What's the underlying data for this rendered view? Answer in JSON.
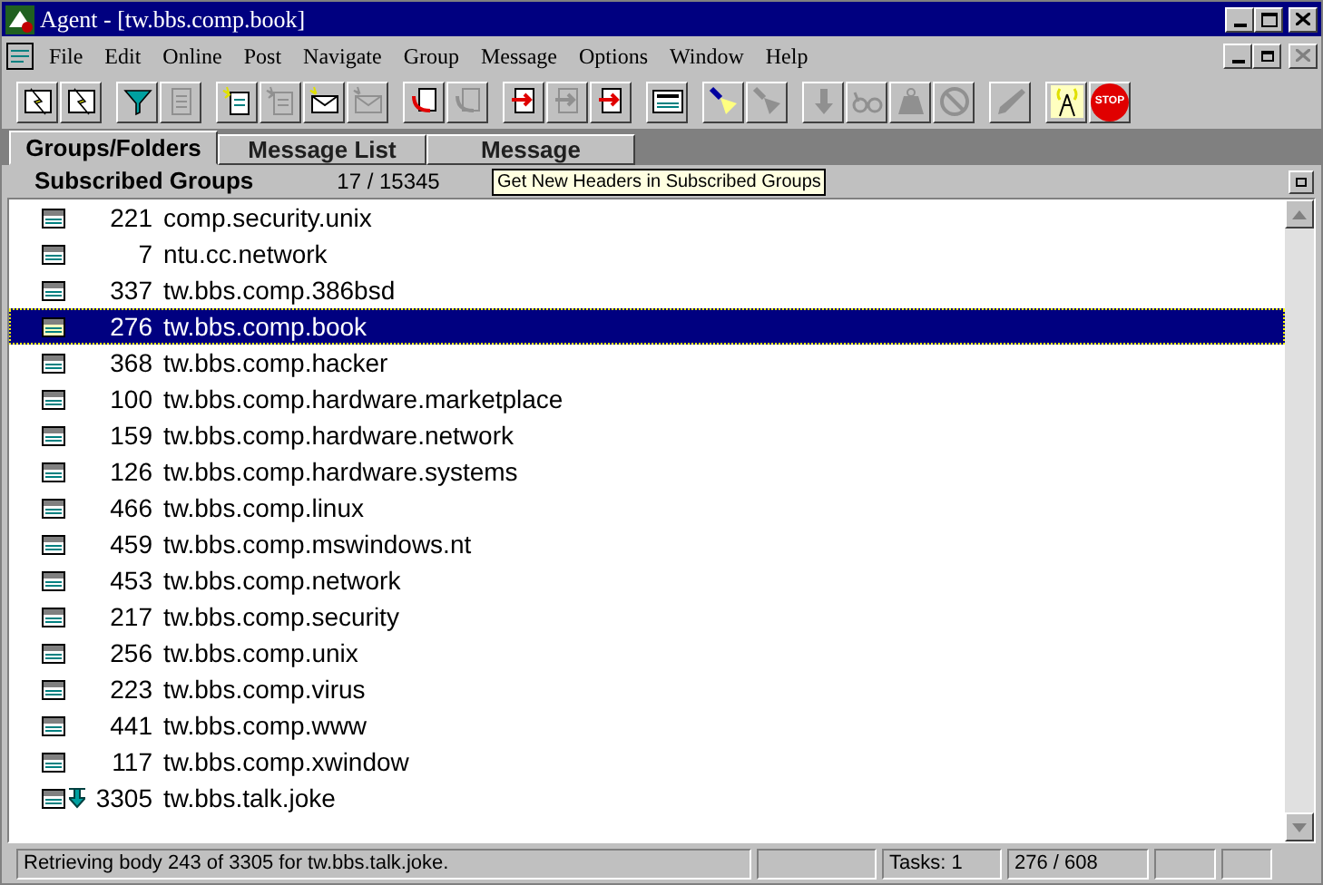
{
  "window": {
    "title": "Agent - [tw.bbs.comp.book]"
  },
  "menu": [
    "File",
    "Edit",
    "Online",
    "Post",
    "Navigate",
    "Group",
    "Message",
    "Options",
    "Window",
    "Help"
  ],
  "toolbar": [
    {
      "kind": "lightning",
      "disabled": false
    },
    {
      "kind": "lightning",
      "disabled": false
    },
    {
      "kind": "sep"
    },
    {
      "kind": "funnel",
      "disabled": false
    },
    {
      "kind": "page",
      "disabled": true
    },
    {
      "kind": "sep"
    },
    {
      "kind": "newpage",
      "disabled": false
    },
    {
      "kind": "newpage",
      "disabled": true
    },
    {
      "kind": "mail",
      "disabled": false
    },
    {
      "kind": "mail",
      "disabled": true
    },
    {
      "kind": "sep"
    },
    {
      "kind": "reply",
      "disabled": false
    },
    {
      "kind": "reply",
      "disabled": true
    },
    {
      "kind": "sep"
    },
    {
      "kind": "forward",
      "disabled": false
    },
    {
      "kind": "forward",
      "disabled": true
    },
    {
      "kind": "forward",
      "disabled": false
    },
    {
      "kind": "sep"
    },
    {
      "kind": "extra",
      "disabled": false
    },
    {
      "kind": "sep"
    },
    {
      "kind": "flashlight",
      "disabled": false
    },
    {
      "kind": "flashlight",
      "disabled": true
    },
    {
      "kind": "sep"
    },
    {
      "kind": "down",
      "disabled": true
    },
    {
      "kind": "glasses",
      "disabled": true
    },
    {
      "kind": "weight",
      "disabled": true
    },
    {
      "kind": "nosign",
      "disabled": true
    },
    {
      "kind": "sep"
    },
    {
      "kind": "pen",
      "disabled": true
    },
    {
      "kind": "sep"
    },
    {
      "kind": "antenna",
      "disabled": false
    },
    {
      "kind": "stop",
      "disabled": false,
      "label": "STOP"
    }
  ],
  "tabs": [
    {
      "label": "Groups/Folders",
      "selected": true
    },
    {
      "label": "Message List",
      "selected": false
    },
    {
      "label": "Message",
      "selected": false
    }
  ],
  "tooltip": "Get New Headers in Subscribed Groups",
  "panel": {
    "title": "Subscribed Groups",
    "count": "17 / 15345"
  },
  "groups": [
    {
      "count": "221",
      "name": "comp.security.unix",
      "selected": false,
      "retrieving": false
    },
    {
      "count": "7",
      "name": "ntu.cc.network",
      "selected": false,
      "retrieving": false
    },
    {
      "count": "337",
      "name": "tw.bbs.comp.386bsd",
      "selected": false,
      "retrieving": false
    },
    {
      "count": "276",
      "name": "tw.bbs.comp.book",
      "selected": true,
      "retrieving": false
    },
    {
      "count": "368",
      "name": "tw.bbs.comp.hacker",
      "selected": false,
      "retrieving": false
    },
    {
      "count": "100",
      "name": "tw.bbs.comp.hardware.marketplace",
      "selected": false,
      "retrieving": false
    },
    {
      "count": "159",
      "name": "tw.bbs.comp.hardware.network",
      "selected": false,
      "retrieving": false
    },
    {
      "count": "126",
      "name": "tw.bbs.comp.hardware.systems",
      "selected": false,
      "retrieving": false
    },
    {
      "count": "466",
      "name": "tw.bbs.comp.linux",
      "selected": false,
      "retrieving": false
    },
    {
      "count": "459",
      "name": "tw.bbs.comp.mswindows.nt",
      "selected": false,
      "retrieving": false
    },
    {
      "count": "453",
      "name": "tw.bbs.comp.network",
      "selected": false,
      "retrieving": false
    },
    {
      "count": "217",
      "name": "tw.bbs.comp.security",
      "selected": false,
      "retrieving": false
    },
    {
      "count": "256",
      "name": "tw.bbs.comp.unix",
      "selected": false,
      "retrieving": false
    },
    {
      "count": "223",
      "name": "tw.bbs.comp.virus",
      "selected": false,
      "retrieving": false
    },
    {
      "count": "441",
      "name": "tw.bbs.comp.www",
      "selected": false,
      "retrieving": false
    },
    {
      "count": "117",
      "name": "tw.bbs.comp.xwindow",
      "selected": false,
      "retrieving": false
    },
    {
      "count": "3305",
      "name": "tw.bbs.talk.joke",
      "selected": false,
      "retrieving": true
    }
  ],
  "status_bar": {
    "message": "Retrieving body 243 of 3305 for tw.bbs.talk.joke.",
    "tasks": "Tasks: 1",
    "position": "276 / 608"
  }
}
